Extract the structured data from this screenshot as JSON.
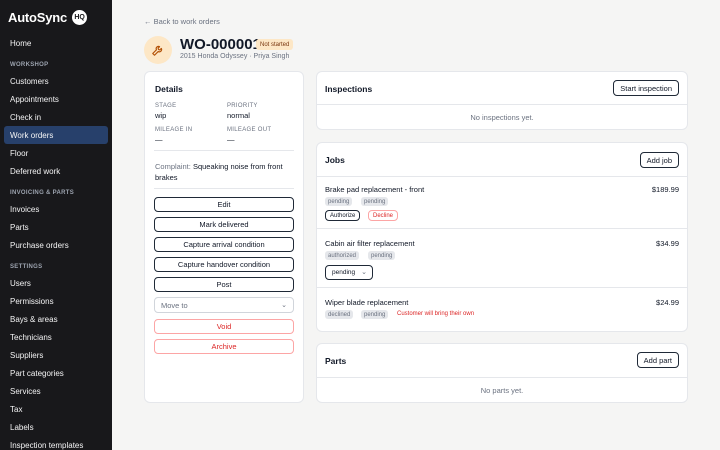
{
  "brand": {
    "name": "AutoSync",
    "badge": "HQ"
  },
  "sidebar": {
    "home": "Home",
    "sections": [
      {
        "title": "WORKSHOP",
        "items": [
          "Customers",
          "Appointments",
          "Check in",
          "Work orders",
          "Floor",
          "Deferred work"
        ]
      },
      {
        "title": "INVOICING & PARTS",
        "items": [
          "Invoices",
          "Parts",
          "Purchase orders"
        ]
      },
      {
        "title": "SETTINGS",
        "items": [
          "Users",
          "Permissions",
          "Bays & areas",
          "Technicians",
          "Suppliers",
          "Part categories",
          "Services",
          "Tax",
          "Labels",
          "Inspection templates"
        ]
      }
    ],
    "active": "Work orders"
  },
  "header": {
    "back": "← Back to work orders",
    "title": "WO-000001",
    "status": "Not started",
    "subtitle": "2015 Honda Odyssey · Priya Singh"
  },
  "details": {
    "title": "Details",
    "stage_label": "STAGE",
    "stage_value": "wip",
    "priority_label": "PRIORITY",
    "priority_value": "normal",
    "mileage_in_label": "MILEAGE IN",
    "mileage_in_value": "—",
    "mileage_out_label": "MILEAGE OUT",
    "mileage_out_value": "—",
    "complaint_label": "Complaint:",
    "complaint_text": "Squeaking noise from front brakes",
    "buttons": {
      "edit": "Edit",
      "mark_delivered": "Mark delivered",
      "capture_arrival": "Capture arrival condition",
      "capture_handover": "Capture handover condition",
      "post": "Post",
      "move_to": "Move to",
      "void": "Void",
      "archive": "Archive"
    }
  },
  "inspections": {
    "title": "Inspections",
    "action": "Start inspection",
    "empty": "No inspections yet."
  },
  "jobs": {
    "title": "Jobs",
    "action": "Add job",
    "items": [
      {
        "name": "Brake pad replacement - front",
        "price": "$189.99",
        "tags": [
          "pending",
          "pending"
        ],
        "authorize": "Authorize",
        "decline": "Decline"
      },
      {
        "name": "Cabin air filter replacement",
        "price": "$34.99",
        "tags": [
          "authorized",
          "pending"
        ],
        "select": "pending"
      },
      {
        "name": "Wiper blade replacement",
        "price": "$24.99",
        "tags": [
          "declined",
          "pending"
        ],
        "note": "Customer will bring their own"
      }
    ]
  },
  "parts": {
    "title": "Parts",
    "action": "Add part",
    "empty": "No parts yet."
  },
  "colors": {
    "sidebar_bg": "#18181b",
    "active_bg": "#27406b",
    "status_bg": "#fde7c6",
    "danger": "#dc2626"
  }
}
